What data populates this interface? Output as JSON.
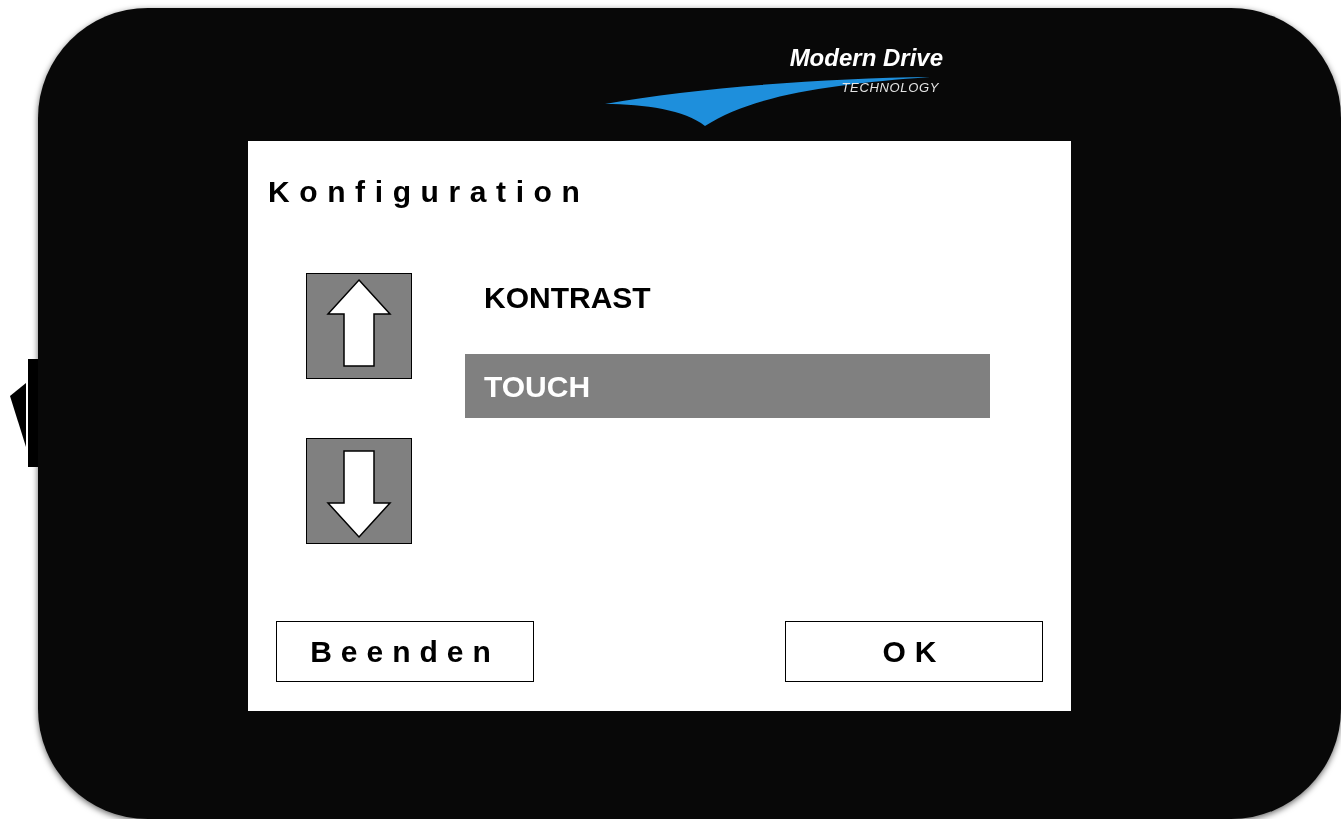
{
  "logo": {
    "name": "Modern Drive",
    "tagline": "TECHNOLOGY"
  },
  "screen": {
    "title": "Konfiguration",
    "scroll_buttons": [
      {
        "kind": "up"
      },
      {
        "kind": "down"
      }
    ],
    "menu_items": [
      {
        "label": "KONTRAST",
        "selected": false
      },
      {
        "label": "TOUCH",
        "selected": true
      }
    ],
    "buttons": [
      "Beenden",
      "OK"
    ]
  }
}
